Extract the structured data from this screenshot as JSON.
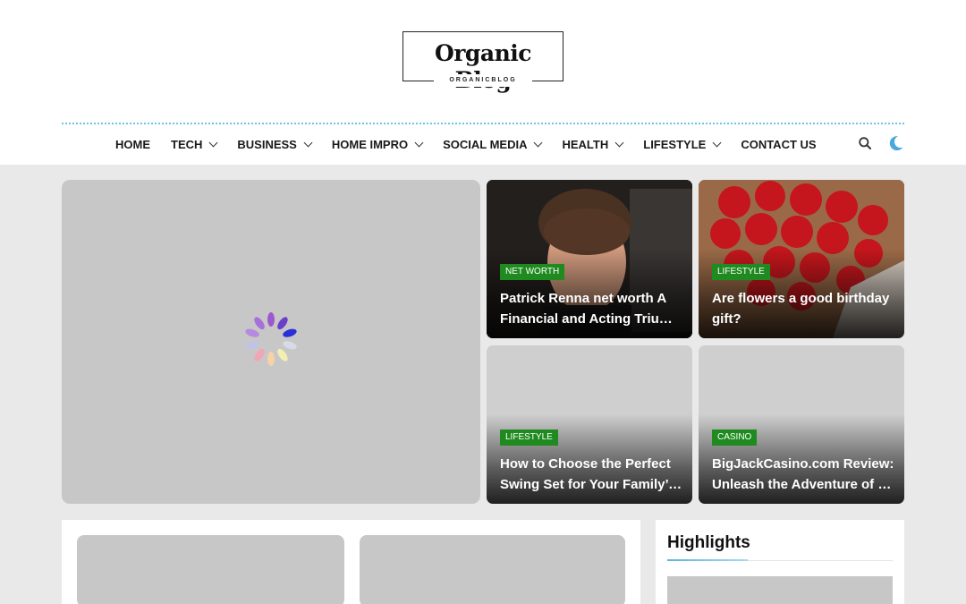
{
  "logo": {
    "title": "Organic Blog",
    "subtitle": "ORGANICBLOG"
  },
  "nav": {
    "items": [
      {
        "label": "HOME",
        "has_dropdown": false
      },
      {
        "label": "TECH",
        "has_dropdown": true
      },
      {
        "label": "BUSINESS",
        "has_dropdown": true
      },
      {
        "label": "HOME IMPRO",
        "has_dropdown": true
      },
      {
        "label": "SOCIAL MEDIA",
        "has_dropdown": true
      },
      {
        "label": "HEALTH",
        "has_dropdown": true
      },
      {
        "label": "LIFESTYLE",
        "has_dropdown": true
      },
      {
        "label": "CONTACT US",
        "has_dropdown": false
      }
    ],
    "icons": [
      "search-icon",
      "moon-icon"
    ]
  },
  "featured": [
    {
      "category": "NET WORTH",
      "title_line1": "Patrick Renna net worth A",
      "title_line2": "Financial and Acting Triumph"
    },
    {
      "category": "LIFESTYLE",
      "title_line1": "Are flowers a good birthday",
      "title_line2": "gift?"
    },
    {
      "category": "LIFESTYLE",
      "title_line1": "How to Choose the Perfect",
      "title_line2": "Swing Set for Your Family’s Backyard"
    },
    {
      "category": "CASINO",
      "title_line1": "BigJackCasino.com Review:",
      "title_line2": "Unleash the Adventure of Online Gaming"
    }
  ],
  "sidebar": {
    "title": "Highlights"
  },
  "colors": {
    "accent": "#6ec4e4",
    "badge": "#1f8a1f",
    "placeholder": "#c7c7c7",
    "background": "#e9e9e9"
  }
}
